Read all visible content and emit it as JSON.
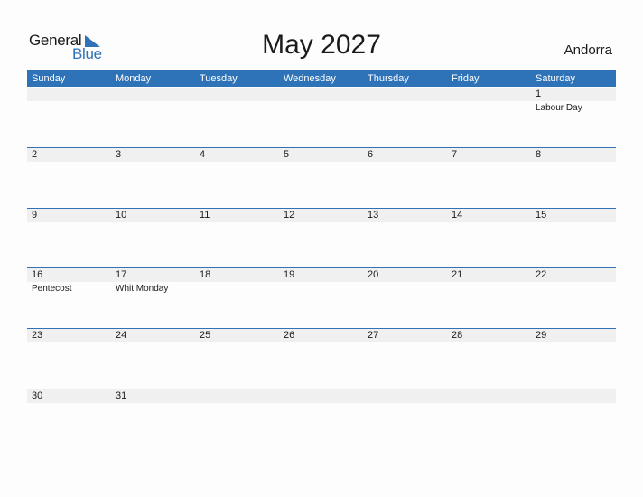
{
  "logo": {
    "general": "General",
    "blue": "Blue"
  },
  "title": "May 2027",
  "country": "Andorra",
  "accent_color": "#2e72b8",
  "weekdays": [
    "Sunday",
    "Monday",
    "Tuesday",
    "Wednesday",
    "Thursday",
    "Friday",
    "Saturday"
  ],
  "weeks": [
    {
      "days": [
        "",
        "",
        "",
        "",
        "",
        "",
        "1"
      ],
      "holidays": [
        "",
        "",
        "",
        "",
        "",
        "",
        "Labour Day"
      ]
    },
    {
      "days": [
        "2",
        "3",
        "4",
        "5",
        "6",
        "7",
        "8"
      ],
      "holidays": [
        "",
        "",
        "",
        "",
        "",
        "",
        ""
      ]
    },
    {
      "days": [
        "9",
        "10",
        "11",
        "12",
        "13",
        "14",
        "15"
      ],
      "holidays": [
        "",
        "",
        "",
        "",
        "",
        "",
        ""
      ]
    },
    {
      "days": [
        "16",
        "17",
        "18",
        "19",
        "20",
        "21",
        "22"
      ],
      "holidays": [
        "Pentecost",
        "Whit Monday",
        "",
        "",
        "",
        "",
        ""
      ]
    },
    {
      "days": [
        "23",
        "24",
        "25",
        "26",
        "27",
        "28",
        "29"
      ],
      "holidays": [
        "",
        "",
        "",
        "",
        "",
        "",
        ""
      ]
    },
    {
      "days": [
        "30",
        "31",
        "",
        "",
        "",
        "",
        ""
      ],
      "holidays": [
        "",
        "",
        "",
        "",
        "",
        "",
        ""
      ]
    }
  ]
}
